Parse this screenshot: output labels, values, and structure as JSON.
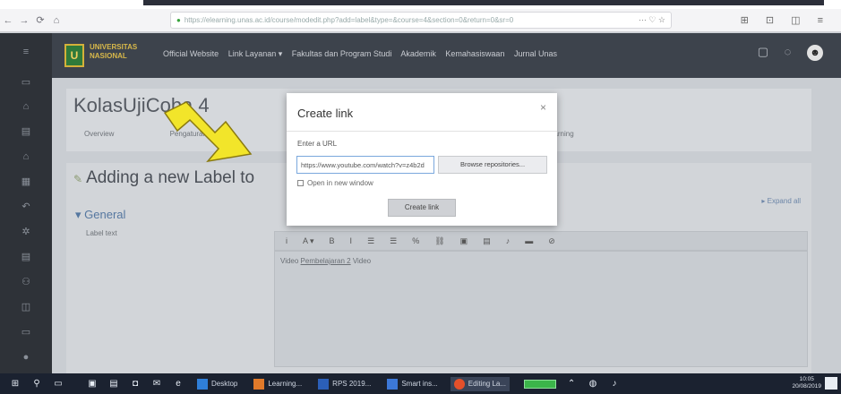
{
  "browser": {
    "nav_back": "←",
    "nav_forward": "→",
    "nav_reload": "⟳",
    "nav_home": "⌂",
    "url": "https://elearning.unas.ac.id/course/modedit.php?add=label&type=&course=4&section=0&return=0&sr=0",
    "url_tools": "···  ♡  ☆",
    "right_icons": "⊞ ⊡ ◫ ≡"
  },
  "header": {
    "logo_glyph": "U",
    "logo_text": "UNIVERSITAS NASIONAL",
    "menu": [
      "Official Website",
      "Link Layanan ▾",
      "Fakultas dan Program Studi",
      "Akademik",
      "Kemahasiswaan",
      "Jurnal Unas"
    ],
    "chat_icon": "▢",
    "bell_icon": "◌",
    "avatar_glyph": "☻"
  },
  "course": {
    "title": "KolasUjiCoba 4",
    "tabs": [
      "Overview",
      "",
      "Pengaturan",
      "",
      "",
      "Video Materi Kelas e-Learning"
    ]
  },
  "form": {
    "heading": "Adding a new Label to",
    "expand_all": "▸ Expand all",
    "section": "▾ General",
    "label_text_caption": "Label text",
    "toolbar": [
      "i",
      "A ▾",
      "B",
      "I",
      "☰",
      "☰",
      "%",
      "⛓",
      "▣",
      "▤",
      "♪",
      "▬",
      "⊘"
    ],
    "editor_prefix": "Video ",
    "editor_link": "Pembelajaran 2",
    "editor_suffix": " Video"
  },
  "modal": {
    "title": "Create link",
    "close": "×",
    "url_label": "Enter a URL",
    "url_value": "https://www.youtube.com/watch?v=z4b2d",
    "browse_label": "Browse repositories...",
    "checkbox_label": "Open in new window",
    "create_label": "Create link"
  },
  "taskbar": {
    "start": "⊞",
    "search": "⚲",
    "apps": [
      "Desktop",
      "Learning...",
      "RPS 2019...",
      "Smart ins...",
      "Editing La..."
    ],
    "clock_time": "10:05",
    "clock_date": "20/08/2019"
  },
  "colors": {
    "arrow_yellow": "#f2e52a",
    "sidebar": "#2e3238",
    "header": "#3d434c",
    "taskbar": "#1b2230"
  }
}
